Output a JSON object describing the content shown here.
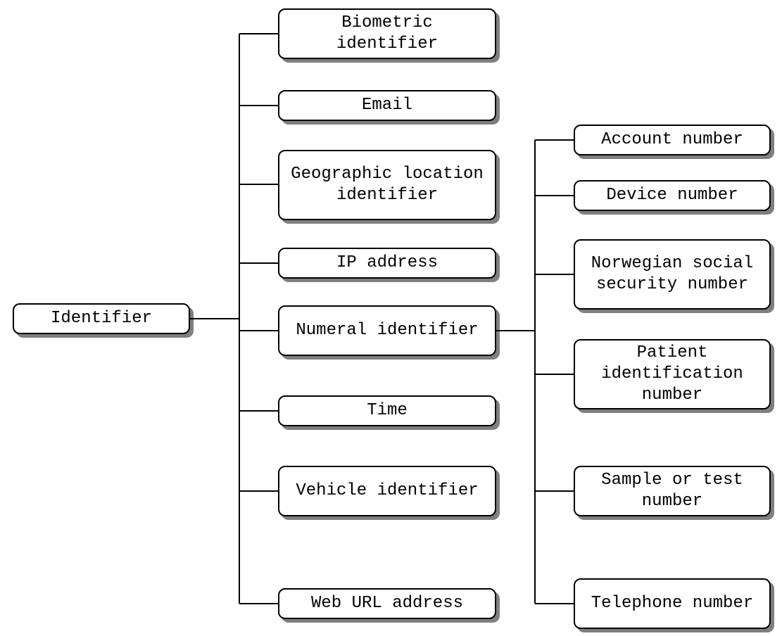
{
  "root": {
    "label": "Identifier"
  },
  "level1": [
    {
      "key": "biometric",
      "label": "Biometric identifier"
    },
    {
      "key": "email",
      "label": "Email"
    },
    {
      "key": "geo",
      "label": "Geographic location identifier"
    },
    {
      "key": "ip",
      "label": "IP address"
    },
    {
      "key": "numeral",
      "label": "Numeral identifier"
    },
    {
      "key": "time",
      "label": "Time"
    },
    {
      "key": "vehicle",
      "label": "Vehicle identifier"
    },
    {
      "key": "weburl",
      "label": "Web URL address"
    }
  ],
  "level2": [
    {
      "key": "account",
      "label": "Account number"
    },
    {
      "key": "device",
      "label": "Device number"
    },
    {
      "key": "norwegian",
      "label": "Norwegian social security number"
    },
    {
      "key": "patient",
      "label": "Patient identification number"
    },
    {
      "key": "sample",
      "label": "Sample or test number"
    },
    {
      "key": "telephone",
      "label": "Telephone number"
    }
  ]
}
